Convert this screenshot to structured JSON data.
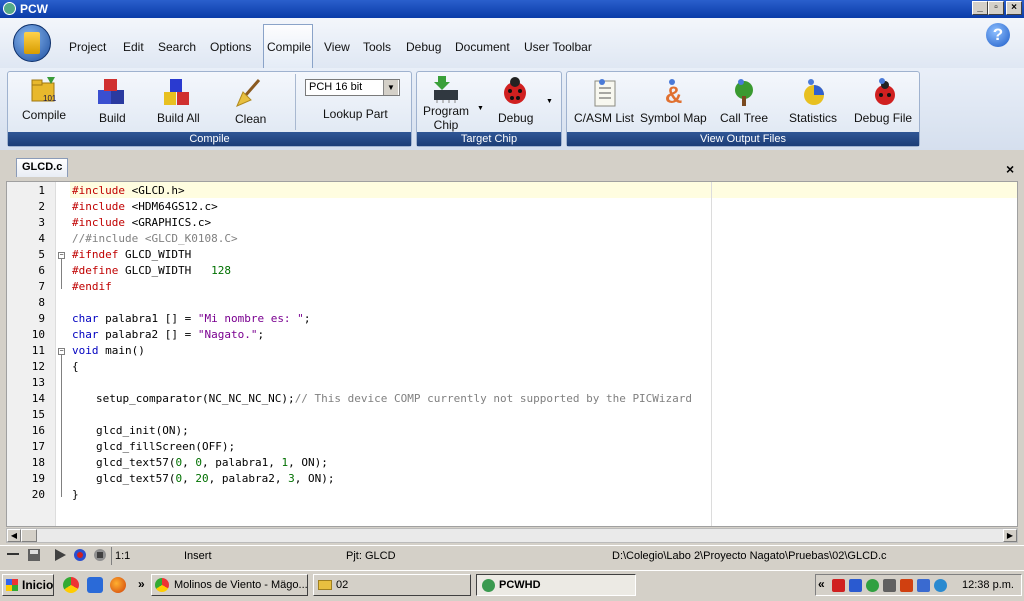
{
  "window": {
    "title": "PCW",
    "min": "_",
    "max": "▫",
    "close": "×"
  },
  "menu": [
    "Project",
    "Edit",
    "Search",
    "Options",
    "Compile",
    "View",
    "Tools",
    "Debug",
    "Document",
    "User Toolbar"
  ],
  "help": "?",
  "ribbon": {
    "compile_group": {
      "label": "Compile",
      "compile": "Compile",
      "build": "Build",
      "build_all": "Build All",
      "clean": "Clean",
      "chip": "PCH 16 bit",
      "lookup": "Lookup Part"
    },
    "target_group": {
      "label": "Target Chip",
      "program_chip_1": "Program",
      "program_chip_2": "Chip",
      "debug": "Debug"
    },
    "output_group": {
      "label": "View Output Files",
      "casm": "C/ASM List",
      "symbol": "Symbol Map",
      "calltree": "Call Tree",
      "stats": "Statistics",
      "debugfile": "Debug File"
    }
  },
  "editor": {
    "file_tab": "GLCD.c",
    "close": "×",
    "lines": [
      "1",
      "2",
      "3",
      "4",
      "5",
      "6",
      "7",
      "8",
      "9",
      "10",
      "11",
      "12",
      "13",
      "14",
      "15",
      "16",
      "17",
      "18",
      "19",
      "20"
    ],
    "code": {
      "l1a": "#include ",
      "l1b": "<GLCD.h>",
      "l2a": "#include ",
      "l2b": "<HDM64GS12.c>",
      "l3a": "#include ",
      "l3b": "<GRAPHICS.c>",
      "l4": "//#include <GLCD_K0108.C>",
      "l5a": "#ifndef ",
      "l5b": "GLCD_WIDTH",
      "l6a": "#define ",
      "l6b": "GLCD_WIDTH   ",
      "l6c": "128",
      "l7": "#endif",
      "l9a": "char",
      "l9b": " palabra1 [] = ",
      "l9c": "\"Mi nombre es: \"",
      "l9d": ";",
      "l10a": "char",
      "l10b": " palabra2 [] = ",
      "l10c": "\"Nagato.\"",
      "l10d": ";",
      "l11a": "void",
      "l11b": " main()",
      "l12": "{",
      "l14a": "setup_comparator(NC_NC_NC_NC);",
      "l14b": "// This device COMP currently not supported by the PICWizard",
      "l16": "glcd_init(ON);",
      "l17": "glcd_fillScreen(OFF);",
      "l18a": "glcd_text57(",
      "l18b": "0",
      "l18c": ", ",
      "l18d": "0",
      "l18e": ", palabra1, ",
      "l18f": "1",
      "l18g": ", ON);",
      "l19a": "glcd_text57(",
      "l19b": "0",
      "l19c": ", ",
      "l19d": "20",
      "l19e": ", palabra2, ",
      "l19f": "3",
      "l19g": ", ON);",
      "l20": "}"
    }
  },
  "status": {
    "position": "1:1",
    "mode": "Insert",
    "project": "Pjt: GLCD",
    "path": "D:\\Colegio\\Labo 2\\Proyecto Nagato\\Pruebas\\02\\GLCD.c"
  },
  "taskbar": {
    "start": "Inicio",
    "more": "»",
    "tasks": [
      "Molinos de Viento - Mägo...",
      "02",
      "PCWHD"
    ],
    "tray_more": "«",
    "clock": "12:38 p.m."
  }
}
